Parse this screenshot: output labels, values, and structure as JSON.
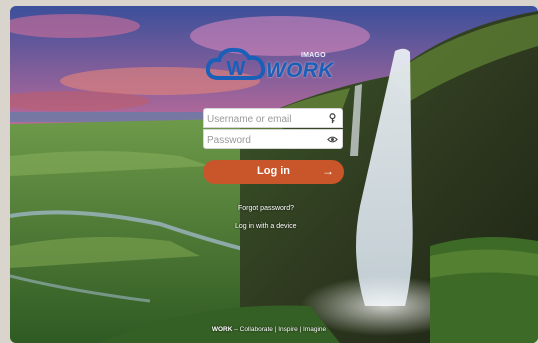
{
  "brand": {
    "sub_label": "IMAGO",
    "name": "WORK",
    "color": "#1a5fb8"
  },
  "login_form": {
    "username_placeholder": "Username or email",
    "password_placeholder": "Password",
    "username_icon": "key-icon",
    "password_icon": "eye-icon",
    "login_label": "Log in",
    "login_arrow": "→",
    "login_color": "#c8562a",
    "forgot_label": "Forgot password?",
    "device_label": "Log in with a device"
  },
  "footer": {
    "brand": "WORK",
    "separator": " – ",
    "tagline": "Collaborate | Inspire | Imagine"
  }
}
